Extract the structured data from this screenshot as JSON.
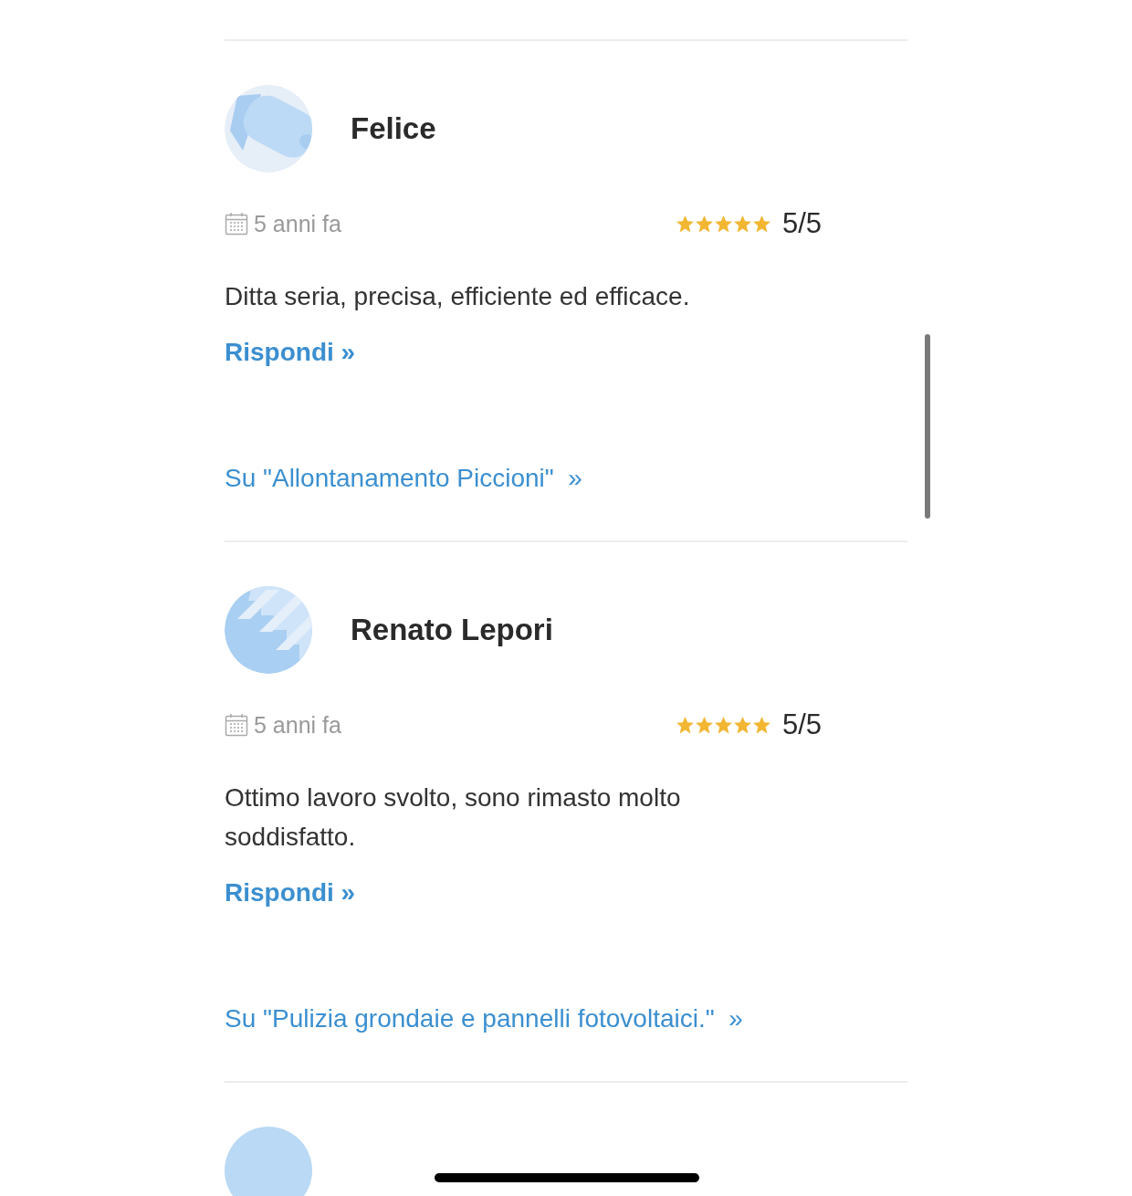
{
  "reviews": [
    {
      "author": "Felice",
      "date": "5 anni fa",
      "stars": 5,
      "score": "5/5",
      "text": "Ditta seria, precisa, efficiente ed efficace.",
      "reply_link": "Rispondi »",
      "service_link": "Su \"Allontanamento Piccioni\"  »"
    },
    {
      "author": "Renato Lepori",
      "date": "5 anni fa",
      "stars": 5,
      "score": "5/5",
      "text": "Ottimo lavoro svolto, sono rimasto molto soddisfatto.",
      "reply_link": "Rispondi »",
      "service_link": "Su \"Pulizia grondaie e pannelli fotovoltaici.\"  »"
    }
  ]
}
